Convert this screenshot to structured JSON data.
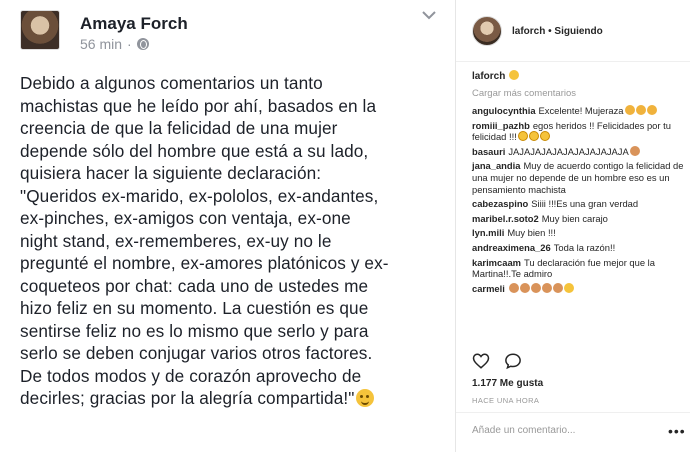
{
  "facebook": {
    "author": "Amaya Forch",
    "time": "56 min",
    "separator": "·",
    "icons": {
      "privacy": "globe-icon",
      "options": "chevron-down-icon",
      "emoji": "wink-emoji-icon"
    },
    "lines": [
      "Debido a algunos comentarios un tanto",
      "machistas que he leído por ahí, basados en la",
      "creencia de que la felicidad de una mujer",
      "depende sólo del hombre que está a su lado,",
      "quisiera hacer la siguiente declaración:",
      "\"Queridos ex-marido, ex-pololos, ex-andantes,",
      "ex-pinches, ex-amigos con ventaja, ex-one",
      "night stand, ex-rememberes, ex-uy no le",
      "pregunté el nombre, ex-amores platónicos y ex-",
      "coqueteos por chat:  cada uno de ustedes me",
      "hizo feliz en su momento. La cuestión es que",
      "sentirse feliz no es lo mismo que serlo y para",
      "serlo se deben conjugar varios otros factores.",
      "De todos modos y de corazón aprovecho de",
      "decirles; gracias por la alegría compartida!\""
    ]
  },
  "instagram": {
    "username": "laforch",
    "follow_status": "Siguiendo",
    "separator": "•",
    "caption_user": "laforch",
    "load_more": "Cargar más comentarios",
    "comments": [
      {
        "user": "angulocynthia",
        "text": "Excelente! Mujeraza",
        "emoji": [
          "clap",
          "clap",
          "clap"
        ]
      },
      {
        "user": "romiii_pazhb",
        "text": "egos heridos !! Felicidades por tu felicidad !!!",
        "emoji": [
          "laugh",
          "laugh",
          "laugh"
        ]
      },
      {
        "user": "basauri",
        "text": "JAJAJAJAJAJAJAJAJAJAJA",
        "emoji": [
          "hand"
        ]
      },
      {
        "user": "jana_andia",
        "text": "Muy de acuerdo contigo la felicidad de una mujer no depende de un hombre eso es un pensamiento machista",
        "emoji": []
      },
      {
        "user": "cabezaspino",
        "text": "Siiii !!!Es una gran verdad",
        "emoji": []
      },
      {
        "user": "maribel.r.soto2",
        "text": "Muy bien carajo",
        "emoji": []
      },
      {
        "user": "lyn.mili",
        "text": "Muy bien !!!",
        "emoji": []
      },
      {
        "user": "andreaximena_26",
        "text": "Toda la razón!!",
        "emoji": []
      },
      {
        "user": "karimcaam",
        "text": "Tu declaración fue mejor que la Martina!!.Te admiro",
        "emoji": []
      },
      {
        "user": "carmeli",
        "text": "",
        "emoji": [
          "hand",
          "hand",
          "hand",
          "hand",
          "hand",
          "smile"
        ]
      }
    ],
    "likes": "1.177 Me gusta",
    "time": "HACE UNA HORA",
    "comment_placeholder": "Añade un comentario...",
    "more_label": "•••",
    "icons": {
      "like": "heart-icon",
      "comment": "comment-bubble-icon"
    }
  },
  "colors": {
    "fb_text": "#1d2129",
    "fb_meta": "#90949c",
    "ig_text": "#262626",
    "ig_muted": "#999999"
  }
}
